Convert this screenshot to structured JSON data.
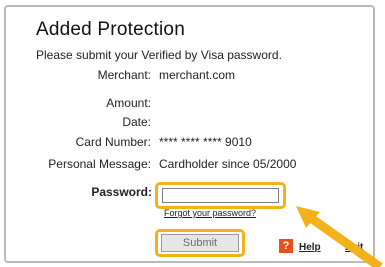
{
  "dialog": {
    "title": "Added Protection",
    "instruction": "Please submit your Verified by Visa password."
  },
  "details": [
    {
      "label": "Merchant:",
      "value": "merchant.com"
    },
    {
      "label": "Amount:",
      "value": ""
    },
    {
      "label": "Date:",
      "value": ""
    },
    {
      "label": "Card Number:",
      "value": "**** **** **** 9010"
    },
    {
      "label": "Personal Message:",
      "value": "Cardholder since 05/2000"
    }
  ],
  "password": {
    "label": "Password:",
    "value": "",
    "forgot_link": "Forgot your password?"
  },
  "actions": {
    "submit_label": "Submit",
    "help_icon_glyph": "?",
    "help_label": "Help",
    "exit_label": "Exit"
  },
  "colors": {
    "highlight": "#f4b21a",
    "help_icon": "#e8501e",
    "arrow": "#f4b21a"
  }
}
